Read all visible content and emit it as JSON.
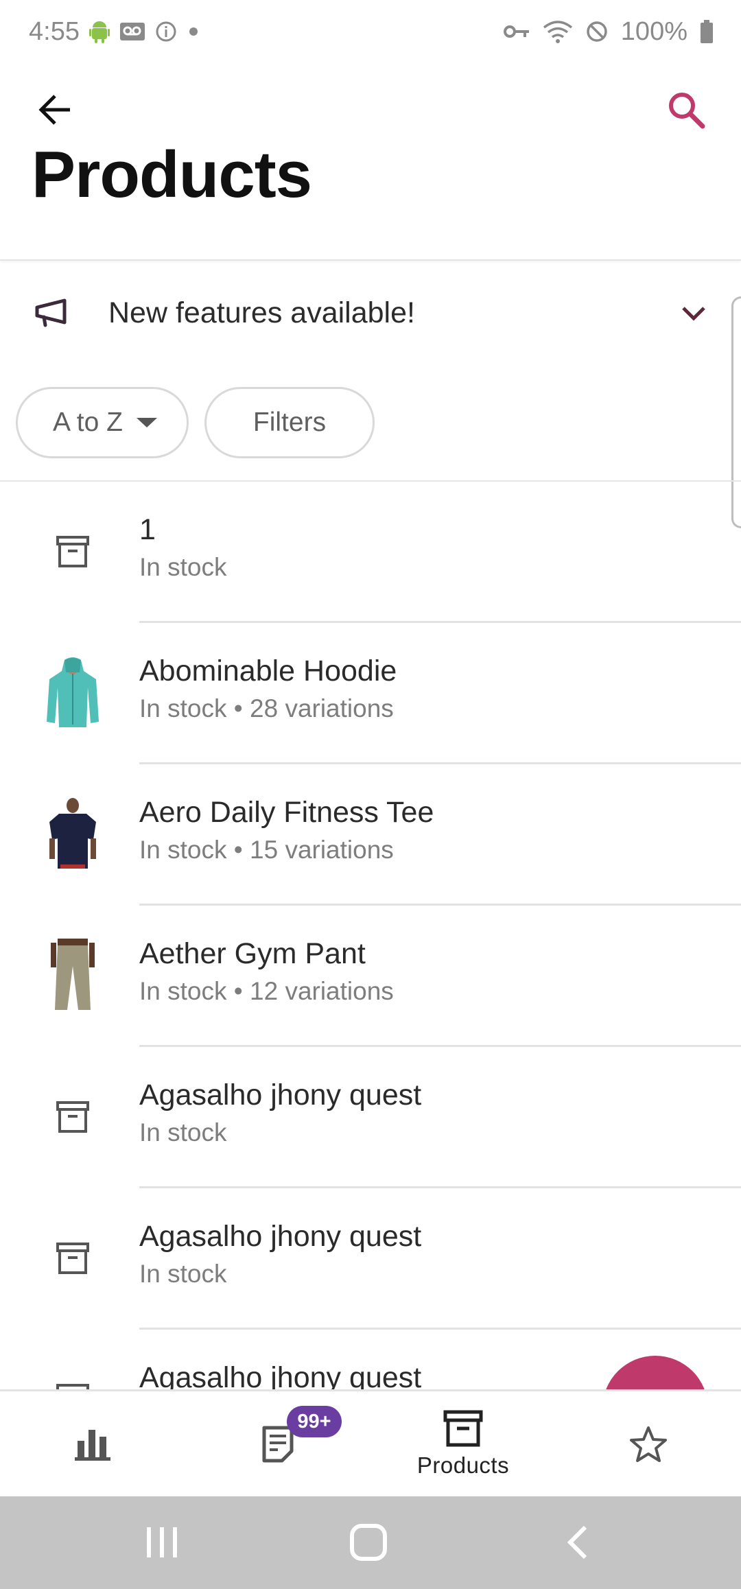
{
  "status_bar": {
    "time": "4:55",
    "battery": "100%"
  },
  "header": {
    "title": "Products"
  },
  "banner": {
    "text": "New features available!"
  },
  "chips": {
    "sort_label": "A to Z",
    "filters_label": "Filters"
  },
  "products": [
    {
      "title": "1",
      "subtitle": "In stock",
      "thumb": "archive-icon"
    },
    {
      "title": "Abominable Hoodie",
      "subtitle": "In stock • 28 variations",
      "thumb": "hoodie-image"
    },
    {
      "title": "Aero Daily Fitness Tee",
      "subtitle": "In stock • 15 variations",
      "thumb": "tee-image"
    },
    {
      "title": "Aether Gym Pant",
      "subtitle": "In stock • 12 variations",
      "thumb": "pant-image"
    },
    {
      "title": "Agasalho jhony quest",
      "subtitle": "In stock",
      "thumb": "archive-icon"
    },
    {
      "title": "Agasalho jhony quest",
      "subtitle": "In stock",
      "thumb": "archive-icon"
    },
    {
      "title": "Agasalho jhony quest",
      "subtitle": "",
      "thumb": "archive-icon"
    }
  ],
  "bottom_nav": {
    "orders_badge": "99+",
    "products_label": "Products"
  },
  "colors": {
    "accent": "#c0396b",
    "badge": "#6a3ea1",
    "system_nav": "#c4c4c4"
  }
}
